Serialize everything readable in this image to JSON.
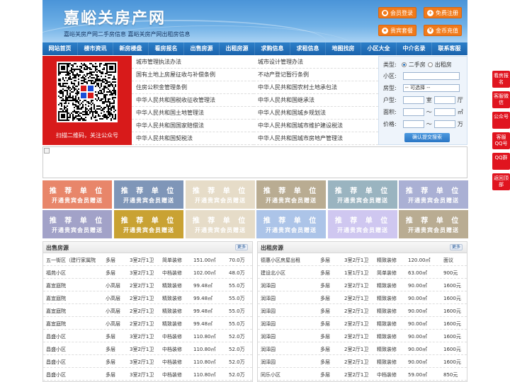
{
  "header": {
    "title": "嘉峪关房产网",
    "subtitle": "嘉峪关房产网二手房信息    嘉峪关房产网出租房信息",
    "buttons": [
      {
        "label": "会员登录",
        "icon": "user-icon"
      },
      {
        "label": "免费注册",
        "icon": "register-icon"
      },
      {
        "label": "贵宾套餐",
        "icon": "vip-icon"
      },
      {
        "label": "金币充值",
        "icon": "coin-icon"
      }
    ]
  },
  "nav": [
    "网站首页",
    "楼市资讯",
    "新房楼盘",
    "看房报名",
    "出售房源",
    "出租房源",
    "求购信息",
    "求租信息",
    "地图找房",
    "小区大全",
    "中介名录",
    "联系客服"
  ],
  "qr": {
    "caption": "扫描二维码，关注公众号"
  },
  "news_left": [
    "城市管理执法办法",
    "国有土地上房屋征收与补偿条例",
    "住房公积金管理条例",
    "中华人民共和国税收征收管理法",
    "中华人民共和国土地管理法",
    "中华人民共和国国家赔偿法",
    "中华人民共和国契税法"
  ],
  "news_right": [
    "城市设计管理办法",
    "不动产登记暂行条例",
    "中华人民共和国农村土地承包法",
    "中华人民共和国继承法",
    "中华人民共和国城乡规划法",
    "中华人民共和国城市维护建设税法",
    "中华人民共和国城市房地产管理法"
  ],
  "search": {
    "type_label": "类型:",
    "type_options": [
      "二手房",
      "出租房"
    ],
    "community_label": "小区:",
    "housetype_label": "房型:",
    "housetype_value": "-- 可选择 --",
    "layout_label": "户型:",
    "room_unit": "室",
    "hall_unit": "厅",
    "area_label": "面积:",
    "area_unit": "㎡",
    "price_label": "价格:",
    "price_unit": "万",
    "tilde": "～",
    "submit": "确认提交搜索"
  },
  "recommend": {
    "line1": "推 荐 单 位",
    "line2": "开通贵宾会员赠送",
    "colors": [
      "#e8866a",
      "#7f96b8",
      "#e6dcc8",
      "#b9ac92",
      "#9ab4c0",
      "#aab0d4",
      "#a2a2c8",
      "#c9a233",
      "#e6dcc8",
      "#acc4e8",
      "#cfc7f0",
      "#b9ac92"
    ]
  },
  "sidebar": [
    "看房报名",
    "客服微信",
    "公众号",
    "客服QQ号",
    "QQ群",
    "返回顶部"
  ],
  "sale": {
    "title": "出售房源",
    "more": "更多",
    "rows": [
      [
        "五一街区（建行家属院",
        "多层",
        "3室2厅1卫",
        "简单装修",
        "151.00㎡",
        "70.0万"
      ],
      [
        "福苑小区",
        "多层",
        "3室2厅1卫",
        "中档装修",
        "102.00㎡",
        "48.0万"
      ],
      [
        "嘉宜庭院",
        "小高层",
        "2室2厅1卫",
        "精致装修",
        "99.48㎡",
        "55.0万"
      ],
      [
        "嘉宜庭院",
        "小高层",
        "2室2厅1卫",
        "精致装修",
        "99.48㎡",
        "55.0万"
      ],
      [
        "嘉宜庭院",
        "小高层",
        "2室2厅1卫",
        "精致装修",
        "99.48㎡",
        "55.0万"
      ],
      [
        "嘉宜庭院",
        "小高层",
        "2室2厅1卫",
        "精致装修",
        "99.48㎡",
        "55.0万"
      ],
      [
        "昌盛小区",
        "多层",
        "3室2厅1卫",
        "中档装修",
        "110.80㎡",
        "52.0万"
      ],
      [
        "昌盛小区",
        "多层",
        "3室2厅1卫",
        "中档装修",
        "110.80㎡",
        "52.0万"
      ],
      [
        "昌盛小区",
        "多层",
        "3室2厅1卫",
        "中档装修",
        "110.80㎡",
        "52.0万"
      ],
      [
        "昌盛小区",
        "多层",
        "3室2厅1卫",
        "中档装修",
        "110.80㎡",
        "52.0万"
      ]
    ]
  },
  "rent": {
    "title": "出租房源",
    "more": "更多",
    "rows": [
      [
        "德惠小区房屋出租",
        "多层",
        "3室2厅1卫",
        "精致装修",
        "120.00㎡",
        "面议"
      ],
      [
        "建设北小区",
        "多层",
        "1室1厅1卫",
        "简单装修",
        "63.00㎡",
        "900元"
      ],
      [
        "润泽园",
        "多层",
        "2室2厅1卫",
        "精致装修",
        "90.00㎡",
        "1600元"
      ],
      [
        "润泽园",
        "多层",
        "2室2厅1卫",
        "精致装修",
        "90.00㎡",
        "1600元"
      ],
      [
        "润泽园",
        "多层",
        "2室2厅1卫",
        "精致装修",
        "90.00㎡",
        "1600元"
      ],
      [
        "润泽园",
        "多层",
        "2室2厅1卫",
        "精致装修",
        "90.00㎡",
        "1600元"
      ],
      [
        "润泽园",
        "多层",
        "2室2厅1卫",
        "精致装修",
        "90.00㎡",
        "1600元"
      ],
      [
        "润泽园",
        "多层",
        "2室2厅1卫",
        "精致装修",
        "90.00㎡",
        "1600元"
      ],
      [
        "润泽园",
        "多层",
        "2室2厅1卫",
        "精致装修",
        "90.00㎡",
        "1600元"
      ],
      [
        "同乐小区",
        "多层",
        "2室2厅1卫",
        "中档装修",
        "59.00㎡",
        "850元"
      ]
    ]
  }
}
